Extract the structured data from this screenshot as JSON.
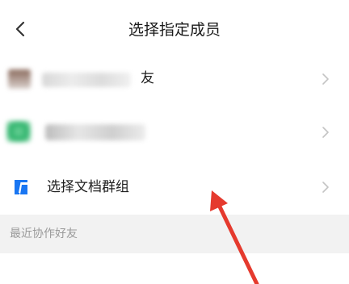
{
  "header": {
    "title": "选择指定成员"
  },
  "rows": [
    {
      "label": "友"
    },
    {
      "label": ""
    },
    {
      "label": "选择文档群组"
    }
  ],
  "section": {
    "label": "最近协作好友"
  },
  "colors": {
    "accent_blue": "#1976f2",
    "friend_green": "#2db36b",
    "section_bg": "#f2f2f2",
    "annotation_red": "#e53a2e"
  },
  "icons": {
    "back": "chevron-left-icon",
    "row_chevron": "chevron-right-icon",
    "doc_group": "doc-group-icon"
  }
}
